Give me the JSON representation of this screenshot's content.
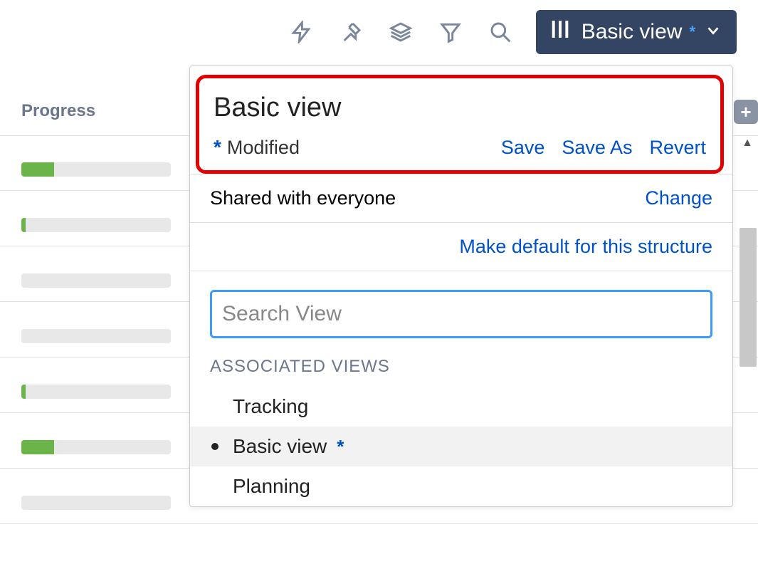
{
  "column": {
    "header": "Progress"
  },
  "progress_rows": [
    {
      "pct": 22
    },
    {
      "pct": 3
    },
    {
      "pct": 0
    },
    {
      "pct": 0
    },
    {
      "pct": 3
    },
    {
      "pct": 22
    },
    {
      "pct": 0
    }
  ],
  "toolbar": {
    "view_label": "Basic view",
    "modified_marker": "*"
  },
  "dropdown": {
    "title": "Basic view",
    "modified_marker": "*",
    "modified_label": "Modified",
    "actions": {
      "save": "Save",
      "save_as": "Save As",
      "revert": "Revert"
    },
    "share_row": {
      "text": "Shared with everyone",
      "change": "Change"
    },
    "default_row": {
      "text": "Make default for this structure"
    },
    "search_placeholder": "Search View",
    "section_label": "ASSOCIATED VIEWS",
    "views": [
      {
        "name": "Tracking",
        "current": false,
        "modified": false
      },
      {
        "name": "Basic view",
        "current": true,
        "modified": true
      },
      {
        "name": "Planning",
        "current": false,
        "modified": false
      }
    ]
  }
}
